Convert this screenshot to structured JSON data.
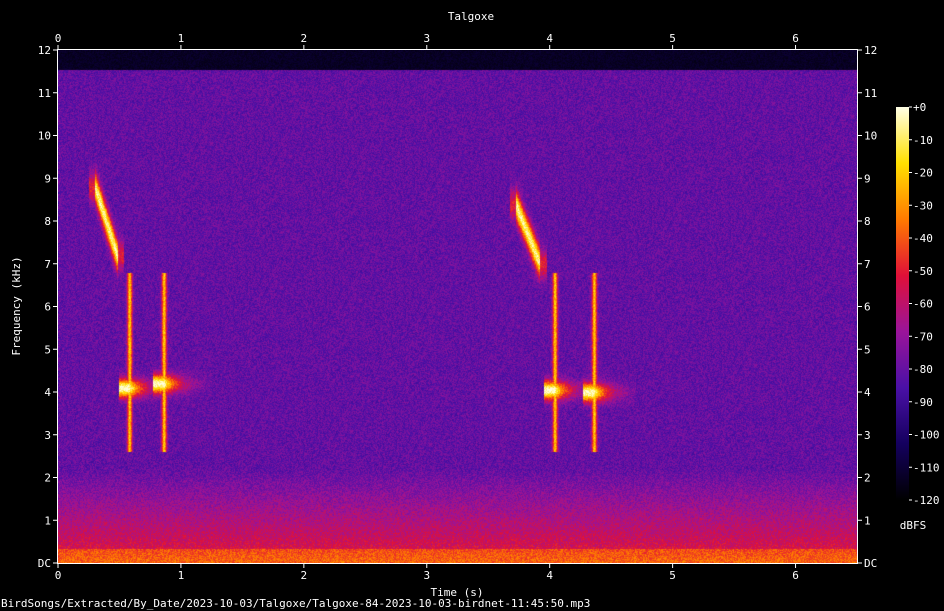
{
  "chart_data": {
    "type": "heatmap",
    "title": "Talgoxe",
    "xlabel": "Time (s)",
    "ylabel": "Frequency (kHz)",
    "xlim": [
      0,
      6.5
    ],
    "ylim": [
      0,
      12
    ],
    "x_ticks": [
      "0",
      "1",
      "2",
      "3",
      "4",
      "5",
      "6"
    ],
    "y_ticks": [
      "DC",
      "1",
      "2",
      "3",
      "4",
      "5",
      "6",
      "7",
      "8",
      "9",
      "10",
      "11",
      "12"
    ],
    "colorbar": {
      "label": "dBFS",
      "range": [
        -120,
        0
      ],
      "ticks": [
        "+0",
        "-10",
        "-20",
        "-30",
        "-40",
        "-50",
        "-60",
        "-70",
        "-80",
        "-90",
        "-100",
        "-110",
        "-120"
      ]
    },
    "colormap_colors": [
      "#000000",
      "#14005e",
      "#4a10a6",
      "#9a149a",
      "#e01038",
      "#ff7a00",
      "#ffe000",
      "#ffffe6"
    ],
    "calls": [
      {
        "t_start": 0.3,
        "t_end": 0.48,
        "f_start": 8.8,
        "f_end": 7.2,
        "type": "sweep"
      },
      {
        "t_start": 0.52,
        "t_end": 0.82,
        "f_center": 4.1,
        "type": "note"
      },
      {
        "t_start": 0.8,
        "t_end": 1.2,
        "f_center": 4.2,
        "type": "note"
      },
      {
        "t_start": 3.72,
        "t_end": 3.92,
        "f_start": 8.4,
        "f_end": 7.0,
        "type": "sweep"
      },
      {
        "t_start": 3.98,
        "t_end": 4.3,
        "f_center": 4.05,
        "type": "note"
      },
      {
        "t_start": 4.3,
        "t_end": 4.65,
        "f_center": 4.0,
        "type": "note"
      }
    ]
  },
  "footer": {
    "filepath": "BirdSongs/Extracted/By_Date/2023-10-03/Talgoxe/Talgoxe-84-2023-10-03-birdnet-11:45:50.mp3"
  }
}
